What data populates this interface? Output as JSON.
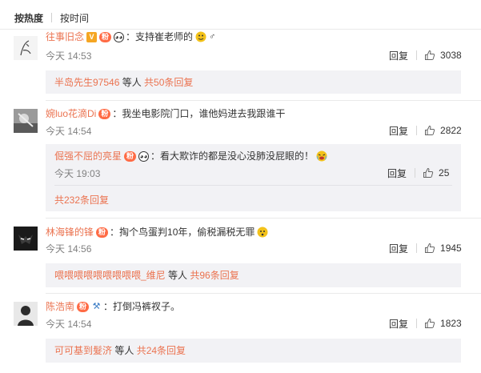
{
  "sort": {
    "hot": "按热度",
    "time": "按时间"
  },
  "labels": {
    "reply": "回复"
  },
  "comments": [
    {
      "username": "往事旧念",
      "text": "支持崔老师的",
      "time": "今天 14:53",
      "likes": "3038",
      "sub": {
        "name": "半岛先生97546",
        "mid": " 等人 ",
        "count": "共50条回复"
      }
    },
    {
      "username": "婉luo花滴Di",
      "text": "我坐电影院门口，谁他妈进去我跟谁干",
      "time": "今天 14:54",
      "likes": "2822",
      "nested": {
        "username": "倔强不屈的亮星",
        "text": "看大欺诈的都是没心没肺没屁眼的！",
        "time": "今天 19:03",
        "likes": "25",
        "total": "共232条回复"
      }
    },
    {
      "username": "林海锋的锋",
      "text": "掏个鸟蛋判10年，偷税漏税无罪",
      "time": "今天 14:56",
      "likes": "1945",
      "sub": {
        "name": "喂喂喂喂喂喂喂喂喂_维尼",
        "mid": " 等人 ",
        "count": "共96条回复"
      }
    },
    {
      "username": "陈浩南",
      "text": "打倒冯裤衩子。",
      "time": "今天 14:54",
      "likes": "1823",
      "sub": {
        "name": "可可基到髮济",
        "mid": " 等人 ",
        "count": "共24条回复"
      }
    }
  ],
  "badges": {
    "vip": "V",
    "fan": "粉"
  },
  "colors": {
    "accent": "#eb7350",
    "subbox": "#f2f2f5",
    "time": "#808080"
  },
  "icons": [
    "like-icon",
    "panda-icon",
    "emoji-icon",
    "hammer-icon"
  ]
}
